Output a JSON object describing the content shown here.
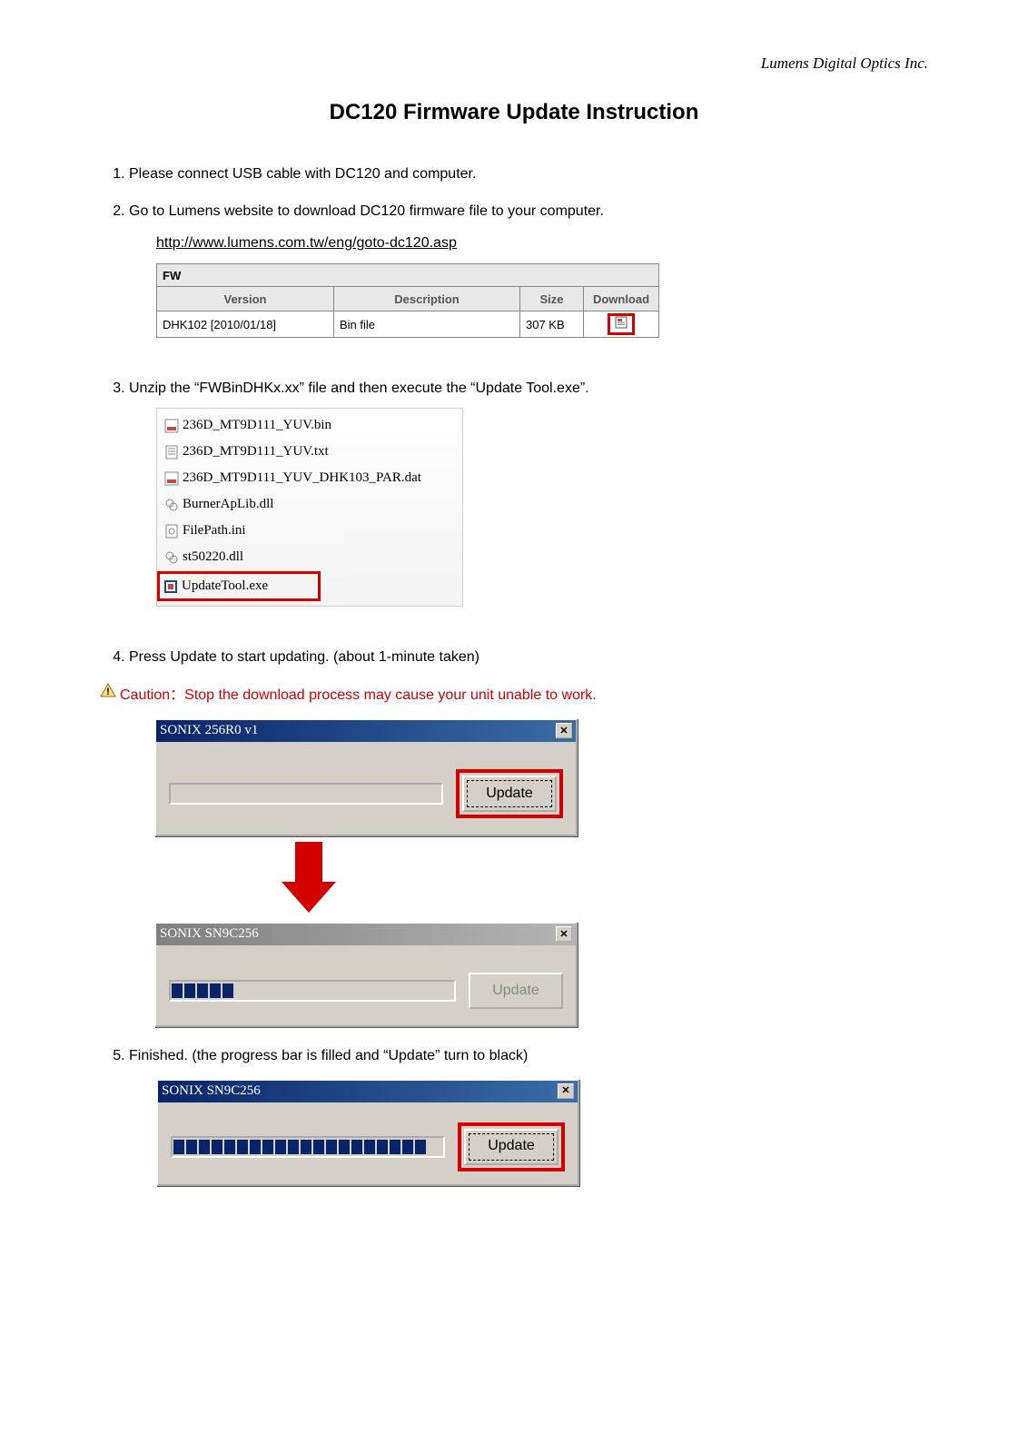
{
  "company": "Lumens Digital Optics Inc.",
  "title": "DC120 Firmware Update Instruction",
  "steps": {
    "s1": "Please connect USB cable with DC120 and computer.",
    "s2": "Go to Lumens website to download DC120 firmware file to your computer.",
    "s2_url": "http://www.lumens.com.tw/eng/goto-dc120.asp",
    "s3": "Unzip the “FWBinDHKx.xx” file and then execute the “Update Tool.exe”.",
    "s4": "Press Update to start updating. (about 1-minute taken)",
    "s5": "Finished. (the progress bar is filled and “Update” turn to black)"
  },
  "caution_label": "Caution：Stop the download process may cause your unit unable to work.",
  "fw_table": {
    "title": "FW",
    "headers": {
      "version": "Version",
      "desc": "Description",
      "size": "Size",
      "download": "Download"
    },
    "row": {
      "version": "DHK102 [2010/01/18]",
      "desc": "Bin file",
      "size": "307 KB"
    }
  },
  "files": [
    "236D_MT9D111_YUV.bin",
    "236D_MT9D111_YUV.txt",
    "236D_MT9D111_YUV_DHK103_PAR.dat",
    "BurnerApLib.dll",
    "FilePath.ini",
    "st50220.dll",
    "UpdateTool.exe"
  ],
  "dialog1": {
    "title": "SONIX 256R0     v1",
    "button": "Update",
    "progress_blocks": 0,
    "active": true
  },
  "dialog2": {
    "title": "SONIX SN9C256",
    "button": "Update",
    "progress_blocks": 5,
    "active": false,
    "disabled": true
  },
  "dialog3": {
    "title": "SONIX SN9C256",
    "button": "Update",
    "progress_blocks": 20,
    "active": true
  }
}
